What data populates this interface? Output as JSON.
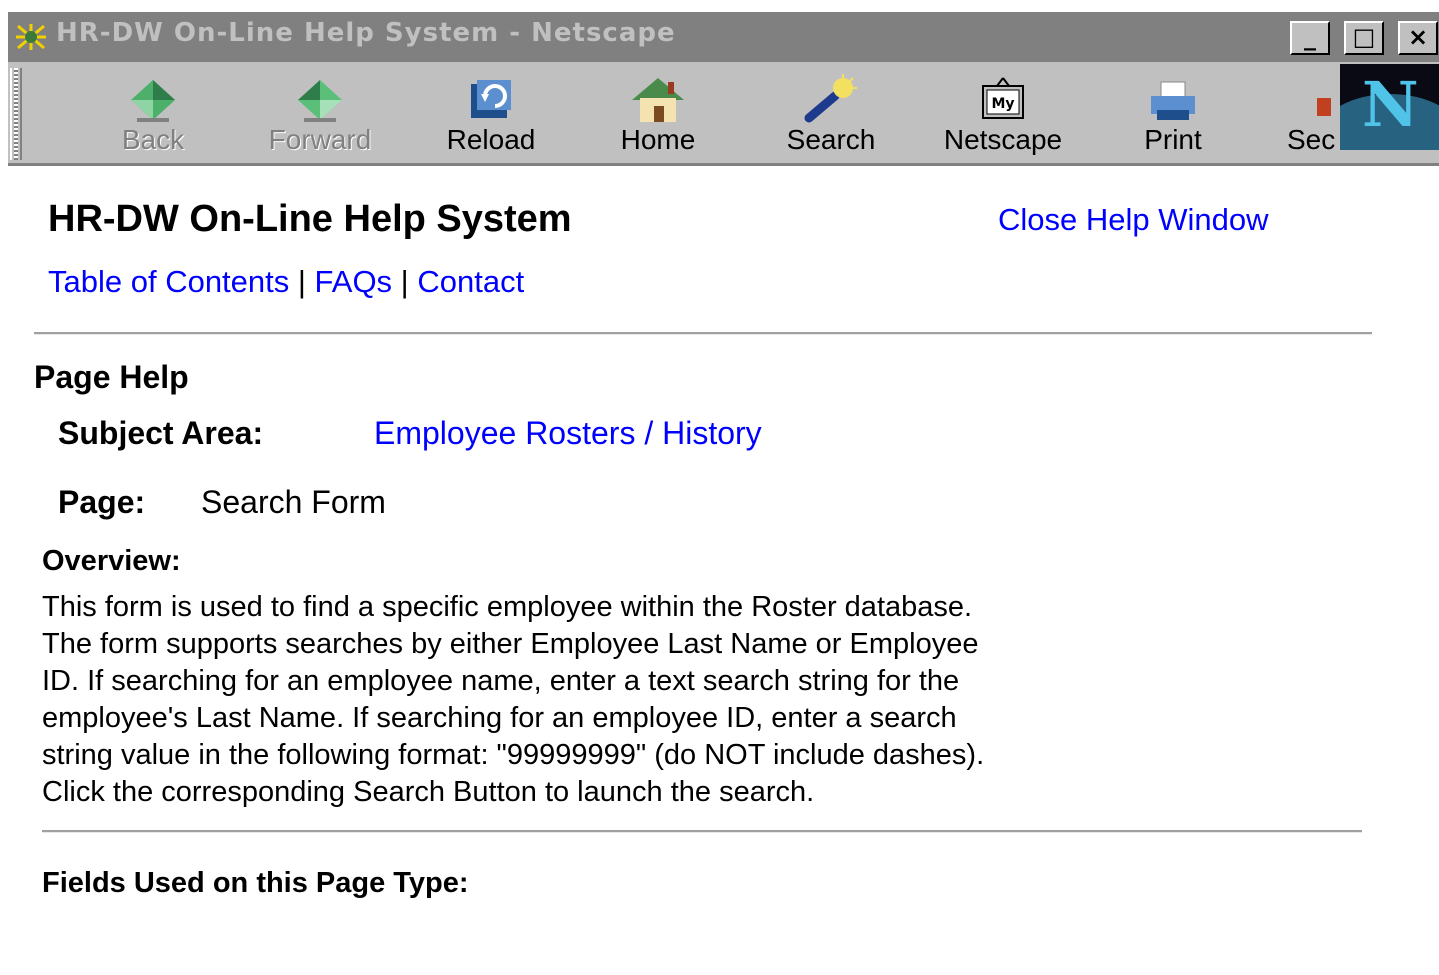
{
  "window": {
    "title": "HR-DW On-Line Help System - Netscape",
    "controls": {
      "minimize": "_",
      "maximize": "□",
      "close": "×"
    }
  },
  "toolbar": {
    "buttons": [
      {
        "label": "Back",
        "icon": "back-arrow-icon",
        "enabled": false
      },
      {
        "label": "Forward",
        "icon": "forward-arrow-icon",
        "enabled": false
      },
      {
        "label": "Reload",
        "icon": "reload-icon",
        "enabled": true
      },
      {
        "label": "Home",
        "icon": "home-icon",
        "enabled": true
      },
      {
        "label": "Search",
        "icon": "search-flashlight-icon",
        "enabled": true
      },
      {
        "label": "Netscape",
        "icon": "my-netscape-icon",
        "enabled": true
      },
      {
        "label": "Print",
        "icon": "printer-icon",
        "enabled": true
      },
      {
        "label": "Sec",
        "icon": "security-lock-icon",
        "enabled": true
      }
    ],
    "logo_letter": "N"
  },
  "page": {
    "heading": "HR-DW On-Line Help System",
    "close_link": "Close Help Window",
    "nav": {
      "toc": "Table of Contents",
      "sep1": " | ",
      "faqs": "FAQs",
      "sep2": " | ",
      "contact": "Contact"
    },
    "section_title": "Page Help",
    "subject_label": "Subject Area:",
    "subject_value": "Employee Rosters / History",
    "page_label": "Page:",
    "page_value": "Search Form",
    "overview_title": "Overview:",
    "overview_lines": [
      "This form is used to find a specific employee within the Roster database.",
      "The form supports searches by either Employee Last Name or Employee",
      "ID. If searching for an employee name, enter a text search string for the",
      "employee's Last Name. If searching for an employee ID, enter a search",
      "string value in the following format: \"99999999\" (do NOT include dashes).",
      "Click the corresponding Search Button to launch the search."
    ],
    "fields_title": "Fields Used on this Page Type:"
  },
  "colors": {
    "link": "#0000ff",
    "titlebar_inactive": "#808080",
    "chrome": "#c0c0c0"
  }
}
